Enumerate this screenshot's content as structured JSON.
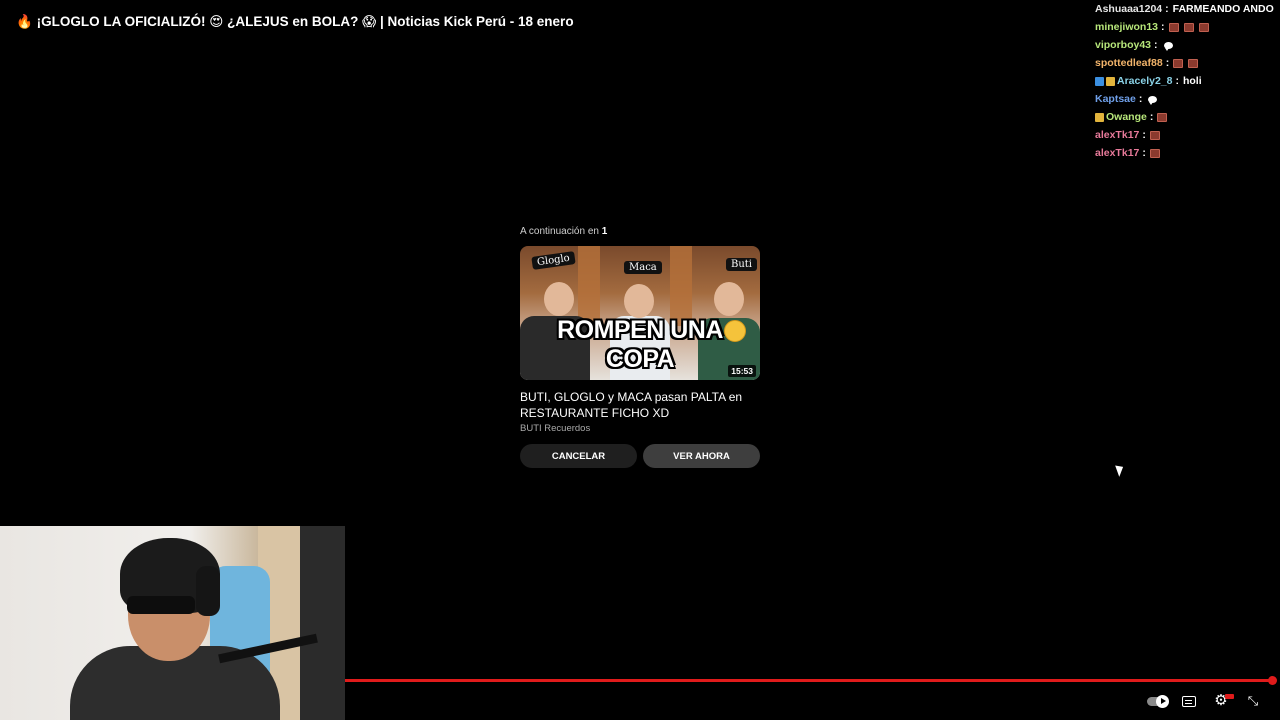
{
  "header": {
    "title": "¡GLOGLO LA OFICIALIZÓ! 😍 ¿ALEJUS en BOLA? 😱 | Noticias Kick Perú - 18 enero",
    "fire_emoji": "🔥"
  },
  "chat": {
    "messages": [
      {
        "user": "Ashuaaa1204",
        "color": "#e6e6e6",
        "text": "FARMEANDO ANDO",
        "emotes": 0,
        "badges": [],
        "bubble": false
      },
      {
        "user": "minejiwon13",
        "color": "#b7e67a",
        "text": "",
        "emotes": 3,
        "badges": [],
        "bubble": false
      },
      {
        "user": "viporboy43",
        "color": "#b7e67a",
        "text": "",
        "emotes": 0,
        "badges": [],
        "bubble": true
      },
      {
        "user": "spottedleaf88",
        "color": "#f2b46b",
        "text": "",
        "emotes": 2,
        "badges": [],
        "bubble": false
      },
      {
        "user": "Aracely2_8",
        "color": "#8bd3e8",
        "text": "holi",
        "emotes": 0,
        "badges": [
          "blue",
          "gold"
        ],
        "bubble": false
      },
      {
        "user": "Kaptsae",
        "color": "#6f9fe8",
        "text": "",
        "emotes": 0,
        "badges": [],
        "bubble": true
      },
      {
        "user": "Owange",
        "color": "#b7e67a",
        "text": "",
        "emotes": 1,
        "badges": [
          "gold"
        ],
        "bubble": false
      },
      {
        "user": "alexTk17",
        "color": "#e87a9a",
        "text": "",
        "emotes": 1,
        "badges": [],
        "bubble": false
      },
      {
        "user": "alexTk17",
        "color": "#e87a9a",
        "text": "",
        "emotes": 1,
        "badges": [],
        "bubble": false
      }
    ],
    "separator": ":"
  },
  "upnext": {
    "label_prefix": "A continuación en",
    "countdown": "1",
    "thumbnail": {
      "names": [
        "Gloglo",
        "Maca",
        "Buti"
      ],
      "caption": "ROMPEN UNA COPA",
      "duration": "15:53"
    },
    "video_title": "BUTI, GLOGLO y MACA pasan PALTA en RESTAURANTE FICHO XD",
    "channel": "BUTI Recuerdos",
    "cancel_label": "CANCELAR",
    "watch_label": "VER AHORA"
  },
  "player": {
    "progress_fraction": 1.0,
    "icons": [
      "autoplay-toggle-icon",
      "subtitles-icon",
      "settings-gear-icon",
      "exit-fullscreen-icon"
    ],
    "accent": "#e01b1b"
  }
}
